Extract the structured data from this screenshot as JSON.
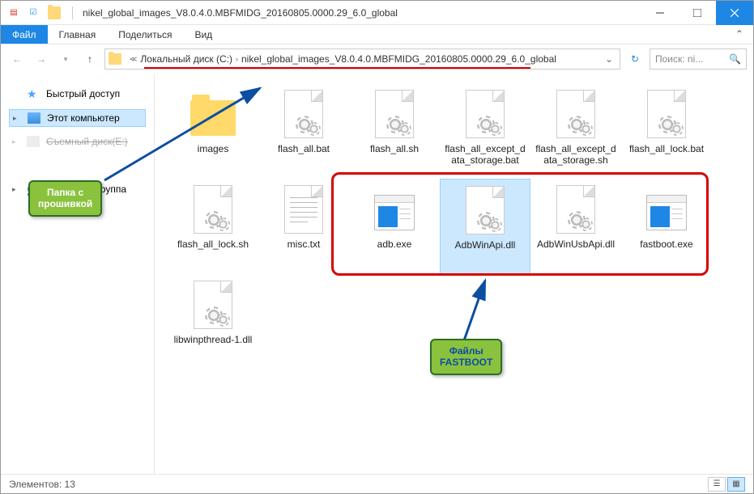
{
  "titlebar": {
    "title": "nikel_global_images_V8.0.4.0.MBFMIDG_20160805.0000.29_6.0_global"
  },
  "ribbon": {
    "file": "Файл",
    "home": "Главная",
    "share": "Поделиться",
    "view": "Вид"
  },
  "address": {
    "crumb_drive": "Локальный диск (C:)",
    "crumb_folder": "nikel_global_images_V8.0.4.0.MBFMIDG_20160805.0000.29_6.0_global"
  },
  "search": {
    "placeholder": "Поиск: ni..."
  },
  "sidebar": {
    "quick": "Быстрый доступ",
    "pc": "Этот компьютер",
    "removable": "Съемный диск(E:)",
    "homegroup": "Домашняя группа"
  },
  "files": {
    "f0": "images",
    "f1": "flash_all.bat",
    "f2": "flash_all.sh",
    "f3": "flash_all_except_data_storage.bat",
    "f4": "flash_all_except_data_storage.sh",
    "f5": "flash_all_lock.bat",
    "f6": "flash_all_lock.sh",
    "f7": "misc.txt",
    "f8": "adb.exe",
    "f9": "AdbWinApi.dll",
    "f10": "AdbWinUsbApi.dll",
    "f11": "fastboot.exe",
    "f12": "libwinpthread-1.dll"
  },
  "annotations": {
    "firmware_folder_l1": "Папка с",
    "firmware_folder_l2": "прошивкой",
    "fastboot_files_l1": "Файлы",
    "fastboot_files_l2": "FASTBOOT"
  },
  "statusbar": {
    "count": "Элементов: 13"
  }
}
